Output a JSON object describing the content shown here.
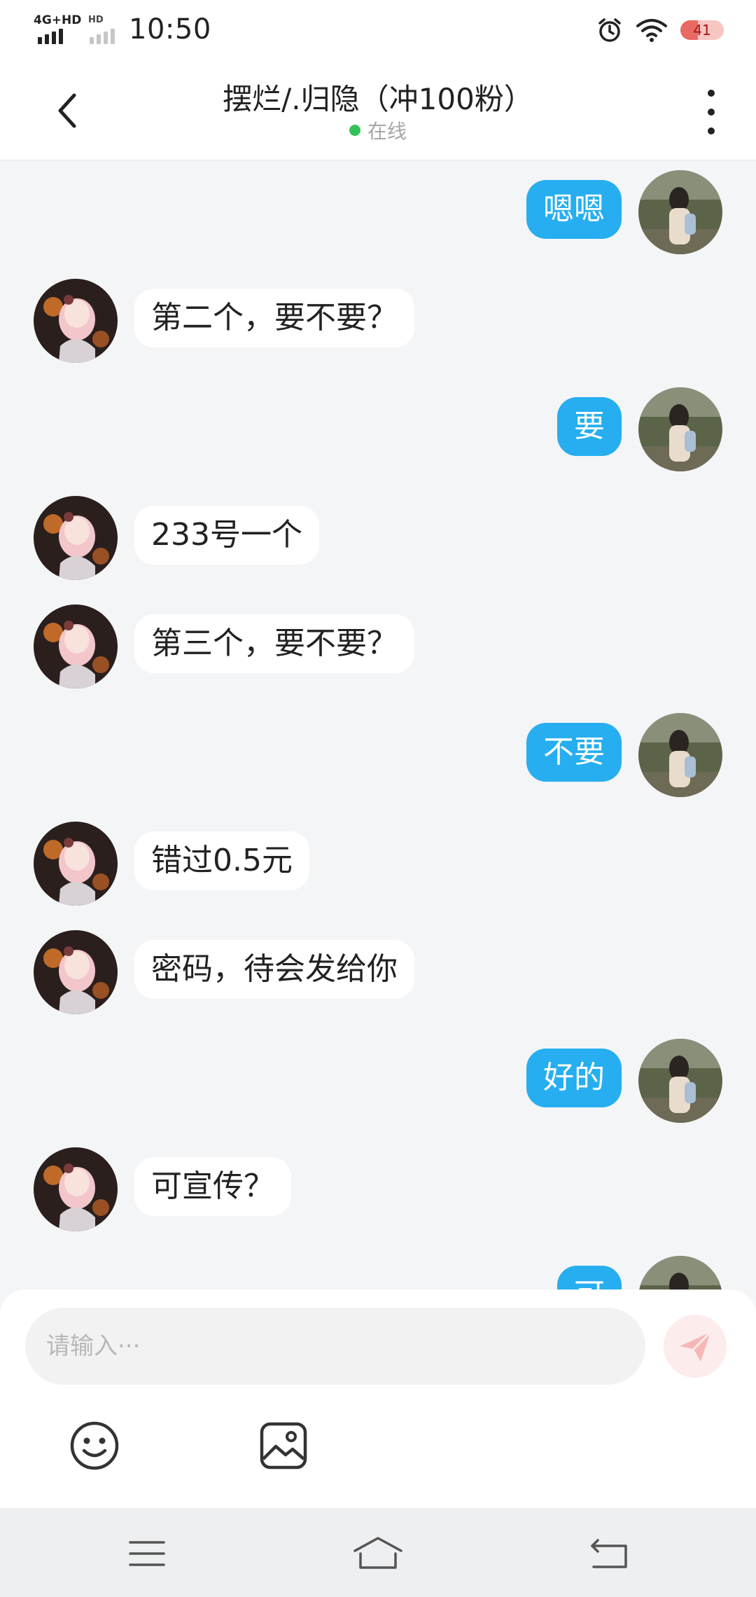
{
  "status_bar": {
    "network_primary": "4G+HD",
    "network_secondary": "HD",
    "time": "10:50",
    "battery": "41",
    "battery_level": 0.41
  },
  "header": {
    "title": "摆烂/.归隐（冲100粉）",
    "status": "在线",
    "status_color": "#35c15a"
  },
  "colors": {
    "sent_bubble": "#26aef0",
    "received_bubble": "#ffffff",
    "background": "#f4f5f7"
  },
  "messages": [
    {
      "side": "right",
      "text": "嗯嗯"
    },
    {
      "side": "left",
      "text": "第二个，要不要？"
    },
    {
      "side": "right",
      "text": "要"
    },
    {
      "side": "left",
      "text": "233号一个"
    },
    {
      "side": "left",
      "text": "第三个，要不要？"
    },
    {
      "side": "right",
      "text": "不要"
    },
    {
      "side": "left",
      "text": "错过0.5元"
    },
    {
      "side": "left",
      "text": "密码，待会发给你"
    },
    {
      "side": "right",
      "text": "好的"
    },
    {
      "side": "left",
      "text": "可宣传？"
    },
    {
      "side": "right",
      "text": "可"
    }
  ],
  "composer": {
    "placeholder": "请输入···",
    "value": ""
  },
  "icons": {
    "back": "chevron-left-icon",
    "more": "more-vertical-icon",
    "send": "send-icon",
    "emoji": "emoji-icon",
    "image": "image-icon",
    "nav_menu": "menu-icon",
    "nav_home": "home-icon",
    "nav_back": "back-icon"
  }
}
